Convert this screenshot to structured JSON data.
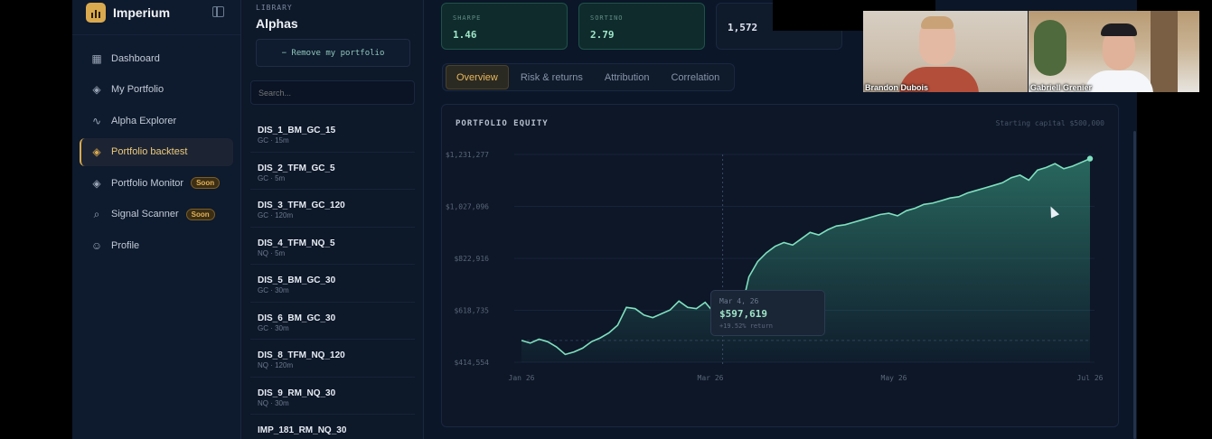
{
  "brand": {
    "name": "Imperium"
  },
  "sidebar": {
    "items": [
      {
        "label": "Dashboard",
        "icon": "grid-icon",
        "glyph": "▦"
      },
      {
        "label": "My Portfolio",
        "icon": "layers-icon",
        "glyph": "◈"
      },
      {
        "label": "Alpha Explorer",
        "icon": "activity-icon",
        "glyph": "∿"
      },
      {
        "label": "Portfolio backtest",
        "icon": "layers-icon",
        "glyph": "◈",
        "active": true
      },
      {
        "label": "Portfolio Monitor",
        "icon": "layers-icon",
        "glyph": "◈",
        "badge": "Soon"
      },
      {
        "label": "Signal Scanner",
        "icon": "search-icon",
        "glyph": "⌕",
        "badge": "Soon"
      },
      {
        "label": "Profile",
        "icon": "user-icon",
        "glyph": "☺"
      }
    ]
  },
  "library": {
    "kicker": "LIBRARY",
    "title": "Alphas",
    "remove_label": "− Remove my portfolio",
    "search_placeholder": "Search...",
    "items": [
      {
        "name": "DIS_1_BM_GC_15",
        "meta": "GC · 15m"
      },
      {
        "name": "DIS_2_TFM_GC_5",
        "meta": "GC · 5m"
      },
      {
        "name": "DIS_3_TFM_GC_120",
        "meta": "GC · 120m"
      },
      {
        "name": "DIS_4_TFM_NQ_5",
        "meta": "NQ · 5m"
      },
      {
        "name": "DIS_5_BM_GC_30",
        "meta": "GC · 30m"
      },
      {
        "name": "DIS_6_BM_GC_30",
        "meta": "GC · 30m"
      },
      {
        "name": "DIS_8_TFM_NQ_120",
        "meta": "NQ · 120m"
      },
      {
        "name": "DIS_9_RM_NQ_30",
        "meta": "NQ · 30m"
      },
      {
        "name": "IMP_181_RM_NQ_30",
        "meta": ""
      }
    ]
  },
  "metrics": [
    {
      "label": "SHARPE",
      "value": "1.46"
    },
    {
      "label": "SORTINO",
      "value": "2.79"
    },
    {
      "label": "",
      "value": "1,572"
    }
  ],
  "tabs": [
    {
      "label": "Overview",
      "active": true
    },
    {
      "label": "Risk & returns"
    },
    {
      "label": "Attribution"
    },
    {
      "label": "Correlation"
    }
  ],
  "panel": {
    "title": "PORTFOLIO EQUITY",
    "note": "Starting capital $500,000"
  },
  "tooltip": {
    "date": "Mar 4, 26",
    "value": "$597,619",
    "sub": "+19.52% return"
  },
  "video": {
    "left_name": "Brandon Dubois",
    "right_name": "Gabriell Grenier"
  },
  "colors": {
    "accent": "#d9a94f",
    "line": "#7fe0bf",
    "panel": "#0d1728"
  },
  "chart_data": {
    "type": "area",
    "title": "PORTFOLIO EQUITY",
    "xlabel": "",
    "ylabel": "",
    "x_ticks": [
      "Jan 26",
      "Mar 26",
      "May 26",
      "Jul 26"
    ],
    "y_ticks": [
      "$414,554",
      "$618,735",
      "$822,916",
      "$1,027,096",
      "$1,231,277"
    ],
    "ylim": [
      414554,
      1231277
    ],
    "grid": true,
    "series": [
      {
        "x": [
          "Jan 26",
          "Jan 26",
          "Jan 26",
          "Jan 26",
          "Jan 26",
          "Feb 26",
          "Feb 26",
          "Feb 26",
          "Feb 26",
          "Feb 26",
          "Feb 26",
          "Feb 26",
          "Feb 26",
          "Feb 26",
          "Feb 26",
          "Feb 26",
          "Feb 26",
          "Feb 26",
          "Feb 26",
          "Feb 26",
          "Mar 26",
          "Mar 26",
          "Mar 26",
          "Mar 26",
          "Mar 26",
          "Mar 26",
          "Mar 26",
          "Mar 26",
          "Mar 26",
          "Mar 26",
          "Mar 26",
          "Mar 26",
          "Apr 26",
          "Apr 26",
          "Apr 26",
          "Apr 26",
          "Apr 26",
          "Apr 26",
          "Apr 26",
          "Apr 26",
          "Apr 26",
          "Apr 26",
          "Apr 26",
          "Apr 26",
          "Apr 26",
          "May 26",
          "May 26",
          "May 26",
          "May 26",
          "May 26",
          "May 26",
          "May 26",
          "May 26",
          "May 26",
          "Jun 26",
          "Jun 26",
          "Jun 26",
          "Jun 26",
          "Jun 26",
          "Jun 26",
          "Jun 26",
          "Jun 26",
          "Jun 26",
          "Jun 26",
          "Jul 26",
          "Jul 26"
        ],
        "values": [
          500000,
          490000,
          505000,
          495000,
          475000,
          445000,
          455000,
          470000,
          495000,
          510000,
          530000,
          560000,
          630000,
          625000,
          600000,
          590000,
          605000,
          620000,
          655000,
          630000,
          625000,
          650000,
          610000,
          597619,
          580000,
          600000,
          750000,
          810000,
          845000,
          870000,
          885000,
          875000,
          900000,
          925000,
          915000,
          935000,
          950000,
          955000,
          965000,
          975000,
          985000,
          995000,
          1000000,
          990000,
          1010000,
          1020000,
          1035000,
          1040000,
          1050000,
          1060000,
          1065000,
          1080000,
          1090000,
          1100000,
          1110000,
          1120000,
          1140000,
          1150000,
          1130000,
          1170000,
          1180000,
          1195000,
          1175000,
          1185000,
          1200000,
          1215000
        ]
      }
    ]
  }
}
